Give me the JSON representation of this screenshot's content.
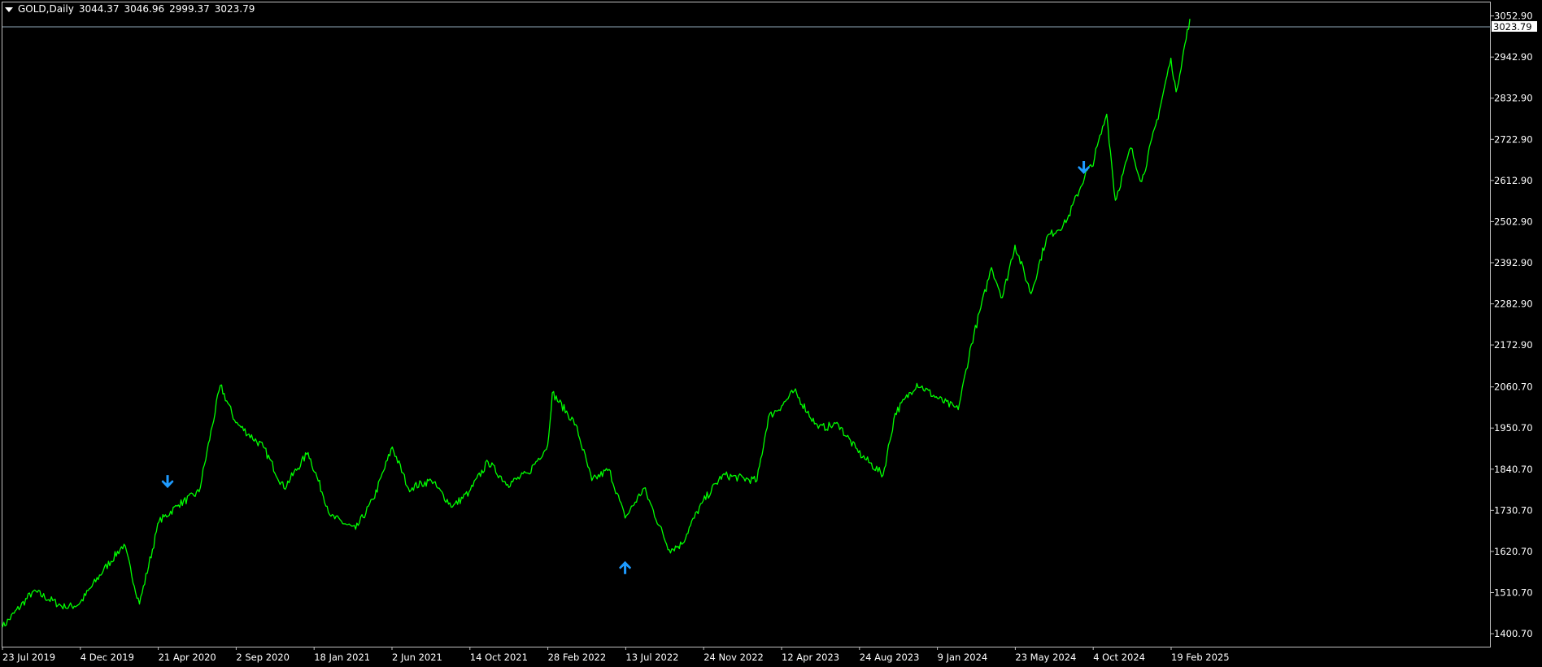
{
  "chart_header": {
    "symbol_timeframe": "GOLD,Daily",
    "open": "3044.37",
    "high": "3046.96",
    "low": "2999.37",
    "close": "3023.79"
  },
  "colors": {
    "background": "#000000",
    "price_line": "#00ff00",
    "arrow": "#1e9bff",
    "grid_border": "#c0c0c0",
    "current_price_line": "#8fa8b8"
  },
  "icons": {
    "header_toggle": "triangle-down-icon",
    "signal_down": "arrow-down-icon",
    "signal_up": "arrow-up-icon"
  },
  "chart_data": {
    "type": "line",
    "title": "",
    "series": [
      {
        "name": "",
        "x": [
          "2019-07-23",
          "2019-09-15",
          "2019-11-10",
          "2019-12-04",
          "2020-01-15",
          "2020-02-20",
          "2020-03-18",
          "2020-04-21",
          "2020-05-25",
          "2020-06-30",
          "2020-08-06",
          "2020-09-02",
          "2020-10-20",
          "2020-11-25",
          "2021-01-06",
          "2021-02-15",
          "2021-03-30",
          "2021-04-30",
          "2021-06-02",
          "2021-06-30",
          "2021-08-09",
          "2021-09-15",
          "2021-10-14",
          "2021-11-16",
          "2021-12-20",
          "2022-01-25",
          "2022-02-28",
          "2022-03-08",
          "2022-04-18",
          "2022-05-16",
          "2022-06-15",
          "2022-07-13",
          "2022-08-15",
          "2022-09-28",
          "2022-10-20",
          "2022-11-04",
          "2022-11-24",
          "2022-12-30",
          "2023-02-28",
          "2023-03-20",
          "2023-04-12",
          "2023-05-04",
          "2023-06-15",
          "2023-07-20",
          "2023-08-24",
          "2023-10-06",
          "2023-10-27",
          "2023-12-04",
          "2024-01-09",
          "2024-02-14",
          "2024-03-08",
          "2024-04-12",
          "2024-05-01",
          "2024-05-23",
          "2024-06-20",
          "2024-07-17",
          "2024-08-20",
          "2024-09-26",
          "2024-10-04",
          "2024-10-30",
          "2024-11-14",
          "2024-12-11",
          "2024-12-30",
          "2025-01-30",
          "2025-02-19",
          "2025-02-28",
          "2025-03-24"
        ],
        "values": [
          1418,
          1515,
          1470,
          1480,
          1570,
          1640,
          1480,
          1700,
          1745,
          1780,
          2065,
          1965,
          1900,
          1790,
          1885,
          1715,
          1680,
          1760,
          1900,
          1790,
          1810,
          1740,
          1780,
          1860,
          1800,
          1830,
          1905,
          2045,
          1960,
          1810,
          1840,
          1710,
          1790,
          1625,
          1640,
          1690,
          1750,
          1825,
          1810,
          1980,
          2010,
          2050,
          1950,
          1960,
          1885,
          1825,
          1990,
          2070,
          2030,
          2000,
          2175,
          2380,
          2300,
          2440,
          2310,
          2460,
          2500,
          2640,
          2650,
          2790,
          2560,
          2700,
          2610,
          2800,
          2940,
          2850,
          3045
        ]
      }
    ],
    "xlabel": "",
    "ylabel": "",
    "x_tick_labels": [
      "23 Jul 2019",
      "4 Dec 2019",
      "21 Apr 2020",
      "2 Sep 2020",
      "18 Jan 2021",
      "2 Jun 2021",
      "14 Oct 2021",
      "28 Feb 2022",
      "13 Jul 2022",
      "24 Nov 2022",
      "12 Apr 2023",
      "24 Aug 2023",
      "9 Jan 2024",
      "23 May 2024",
      "4 Oct 2024",
      "19 Feb 2025"
    ],
    "y_tick_labels": [
      "3052.90",
      "2942.90",
      "2832.90",
      "2722.90",
      "2612.90",
      "2502.90",
      "2392.90",
      "2282.90",
      "2172.90",
      "2060.70",
      "1950.70",
      "1840.70",
      "1730.70",
      "1620.70",
      "1510.70",
      "1400.70"
    ],
    "ylim": [
      1366,
      3089
    ],
    "current_price": "3023.79",
    "grid": false,
    "signals": [
      {
        "type": "down",
        "date": "2020-05-06",
        "price": 1790
      },
      {
        "type": "up",
        "date": "2022-07-13",
        "price": 1595
      },
      {
        "type": "down",
        "date": "2024-09-20",
        "price": 2630
      }
    ]
  }
}
